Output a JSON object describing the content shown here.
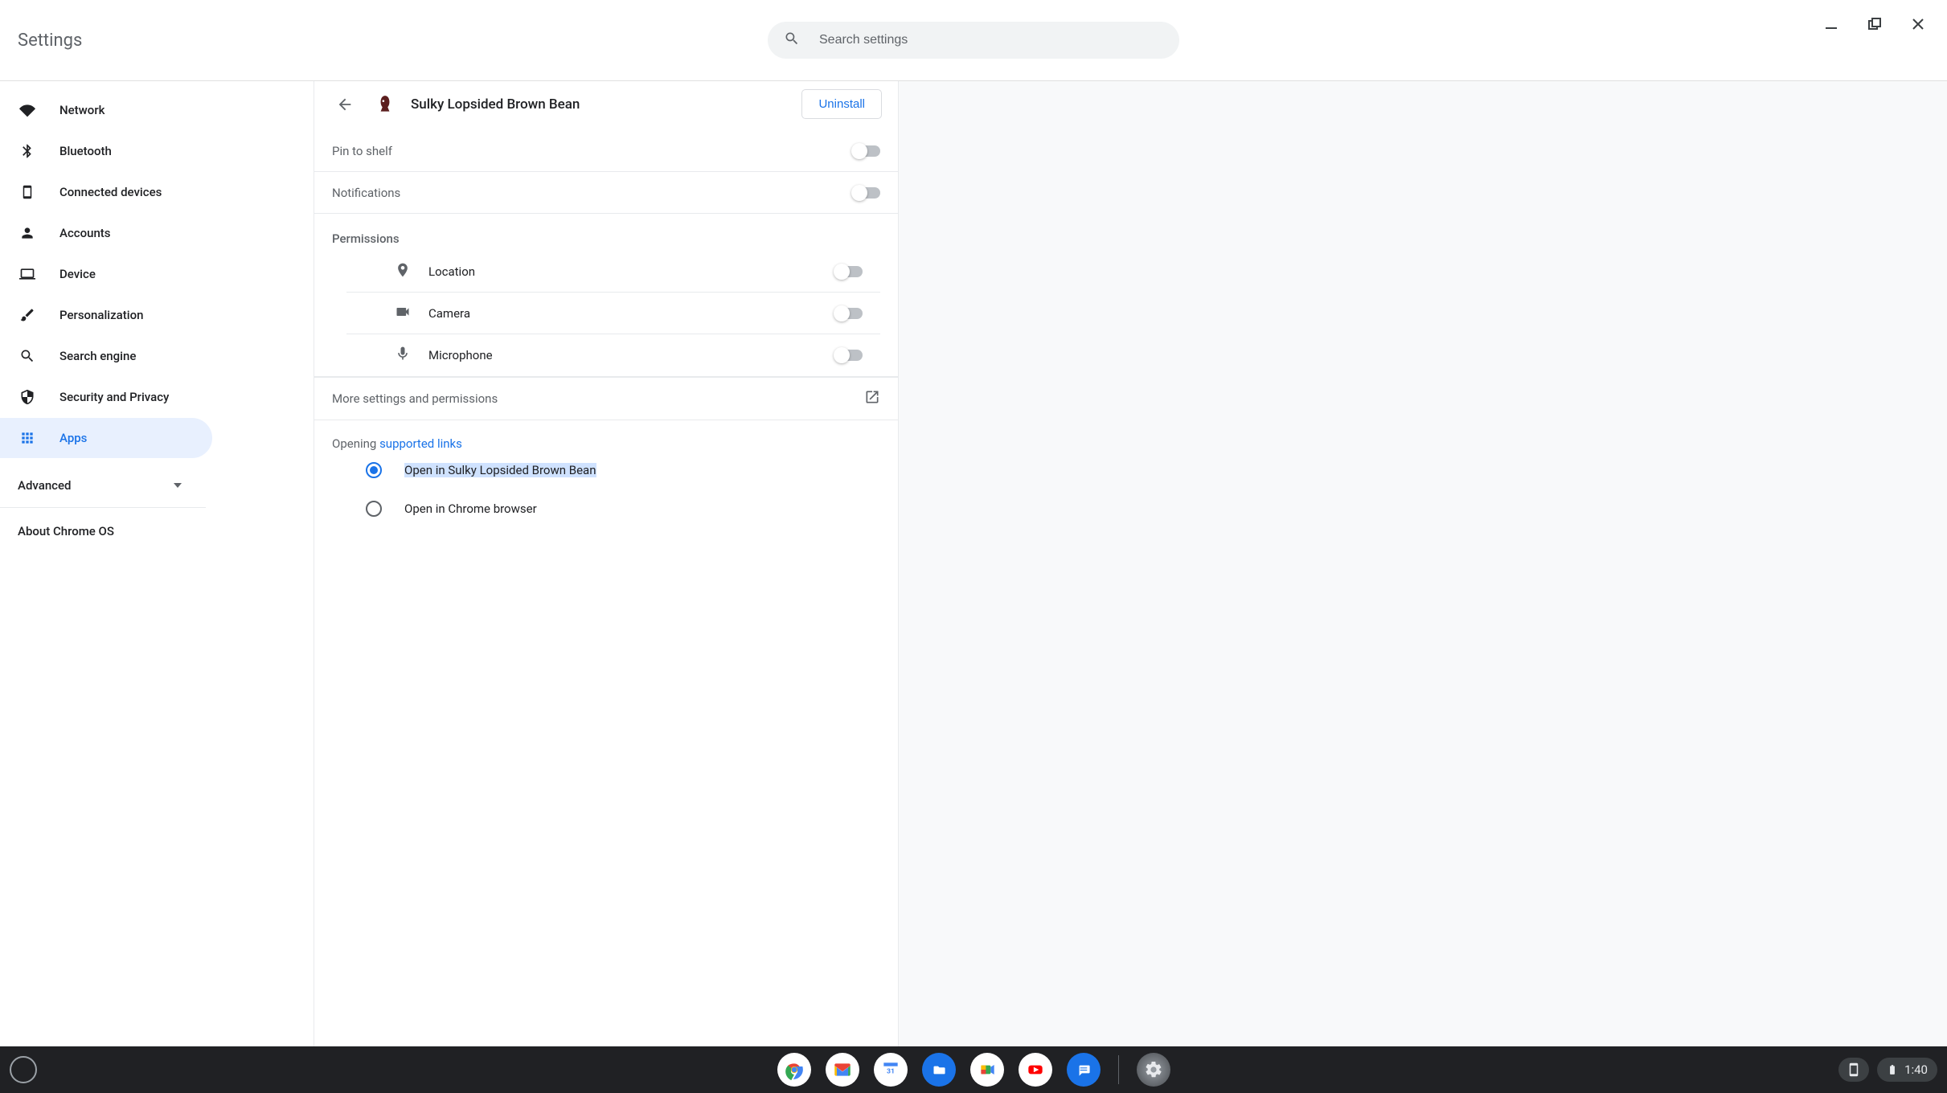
{
  "window": {
    "title": "Settings"
  },
  "search": {
    "placeholder": "Search settings"
  },
  "sidebar": {
    "items": [
      {
        "label": "Network",
        "icon": "wifi"
      },
      {
        "label": "Bluetooth",
        "icon": "bluetooth"
      },
      {
        "label": "Connected devices",
        "icon": "phone"
      },
      {
        "label": "Accounts",
        "icon": "person"
      },
      {
        "label": "Device",
        "icon": "laptop"
      },
      {
        "label": "Personalization",
        "icon": "brush"
      },
      {
        "label": "Search engine",
        "icon": "search"
      },
      {
        "label": "Security and Privacy",
        "icon": "shield"
      },
      {
        "label": "Apps",
        "icon": "apps",
        "active": true
      }
    ],
    "advanced": "Advanced",
    "about": "About Chrome OS"
  },
  "detail": {
    "app_name": "Sulky Lopsided Brown Bean",
    "uninstall": "Uninstall",
    "pin_to_shelf": "Pin to shelf",
    "notifications": "Notifications",
    "permissions_label": "Permissions",
    "permissions": {
      "location": "Location",
      "camera": "Camera",
      "microphone": "Microphone"
    },
    "more": "More settings and permissions",
    "opening_prefix": "Opening ",
    "opening_link": "supported links",
    "radio_open_in_app": "Open in Sulky Lopsided Brown Bean",
    "radio_open_in_chrome": "Open in Chrome browser"
  },
  "shelf": {
    "clock": "1:40"
  }
}
